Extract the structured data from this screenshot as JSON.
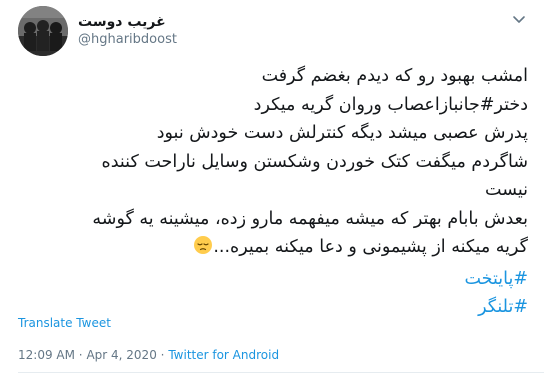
{
  "user": {
    "display_name": "غریب دوست",
    "handle": "@hgharibdoost"
  },
  "tweet": {
    "lines": [
      "امشب بهبود رو که دیدم بغضم گرفت",
      "دختر#جانبازاعصاب وروان گریه میکرد",
      "پدرش عصبی میشد دیگه کنترلش دست خودش نبود",
      "شاگردم میگفت کتک خوردن وشکستن وسایل ناراحت کننده",
      "نیست",
      "بعدش بابام بهتر که میشه میفهمه مارو زده، میشینه یه گوشه",
      "گریه میکنه از پشیمونی و دعا میکنه بمیره..."
    ],
    "hashtags": [
      "#پایتخت",
      "#تلنگر"
    ],
    "emoji": "pensive-face"
  },
  "translate_label": "Translate Tweet",
  "meta": {
    "time": "12:09 AM",
    "separator": "·",
    "date": "Apr 4, 2020",
    "source": "Twitter for Android"
  },
  "colors": {
    "link": "#1b95e0",
    "muted": "#657786",
    "text": "#14171a"
  }
}
